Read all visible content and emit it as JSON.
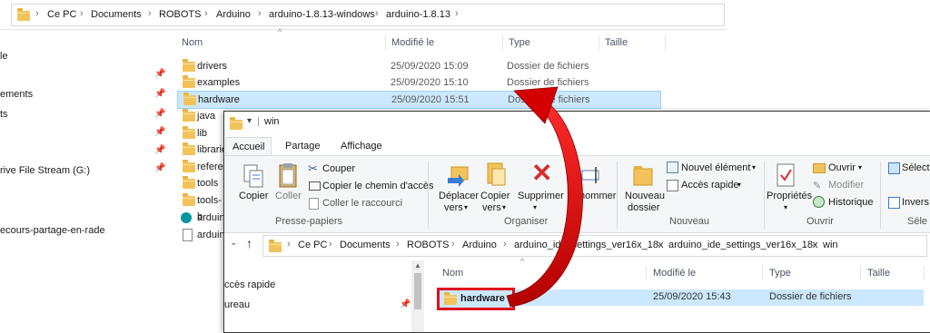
{
  "back": {
    "breadcrumb": [
      "Ce PC",
      "Documents",
      "ROBOTS",
      "Arduino",
      "arduino-1.8.13-windows",
      "arduino-1.8.13"
    ],
    "headers": {
      "name": "Nom",
      "modified": "Modifié le",
      "type": "Type",
      "size": "Taille"
    },
    "nav_items": [
      "le",
      "ements",
      "ts",
      "rive File Stream (G:)",
      "ecours-partage-en-rade"
    ],
    "rows": [
      {
        "name": "drivers",
        "date": "25/09/2020 15:09",
        "type": "Dossier de fichiers"
      },
      {
        "name": "examples",
        "date": "25/09/2020 15:10",
        "type": "Dossier de fichiers"
      },
      {
        "name": "hardware",
        "date": "25/09/2020 15:51",
        "type": "Dossier de fichiers"
      },
      {
        "name": "java",
        "date": "",
        "type": ""
      },
      {
        "name": "lib",
        "date": "",
        "type": ""
      },
      {
        "name": "librarie",
        "date": "",
        "type": ""
      },
      {
        "name": "referen",
        "date": "",
        "type": ""
      },
      {
        "name": "tools",
        "date": "",
        "type": ""
      },
      {
        "name": "tools-b",
        "date": "",
        "type": ""
      },
      {
        "name": "arduin",
        "date": "",
        "type": ""
      },
      {
        "name": "arduin",
        "date": "",
        "type": ""
      }
    ]
  },
  "front": {
    "title": "win",
    "tabs": [
      "Accueil",
      "Partage",
      "Affichage"
    ],
    "ribbon": {
      "copier": "Copier",
      "coller": "Coller",
      "couper": "Couper",
      "copier_chemin": "Copier le chemin d'accès",
      "coller_raccourci": "Coller le raccourci",
      "group_presse": "Presse-papiers",
      "deplacer": "Déplacer",
      "deplacer2": "vers",
      "copier_vers": "Copier",
      "copier_vers2": "vers",
      "supprimer": "Supprimer",
      "renommer": "Renommer",
      "group_organiser": "Organiser",
      "nouveau_dossier": "Nouveau",
      "nouveau_dossier2": "dossier",
      "nouvel_element": "Nouvel élément",
      "acces_rapide": "Accès rapide",
      "group_nouveau": "Nouveau",
      "proprietes": "Propriétés",
      "ouvrir": "Ouvrir",
      "modifier": "Modifier",
      "historique": "Historique",
      "group_ouvrir": "Ouvrir",
      "selectionner": "Sélect",
      "inverser": "Invers",
      "group_selection": "Séle"
    },
    "breadcrumb": [
      "Ce PC",
      "Documents",
      "ROBOTS",
      "Arduino",
      "arduino_ide_settings_ver16x_18x",
      "arduino_ide_settings_ver16x_18x",
      "win"
    ],
    "nav_items": [
      "ccès rapide",
      "ureau"
    ],
    "headers": {
      "name": "Nom",
      "modified": "Modifié le",
      "type": "Type",
      "size": "Taille"
    },
    "rows": [
      {
        "name": "hardware",
        "date": "25/09/2020 15:43",
        "type": "Dossier de fichiers"
      }
    ]
  },
  "colors": {
    "highlight": "#cce8ff",
    "red_box": "#e0101b",
    "arrow": "#e0101b",
    "folder": "#f3c35b"
  }
}
